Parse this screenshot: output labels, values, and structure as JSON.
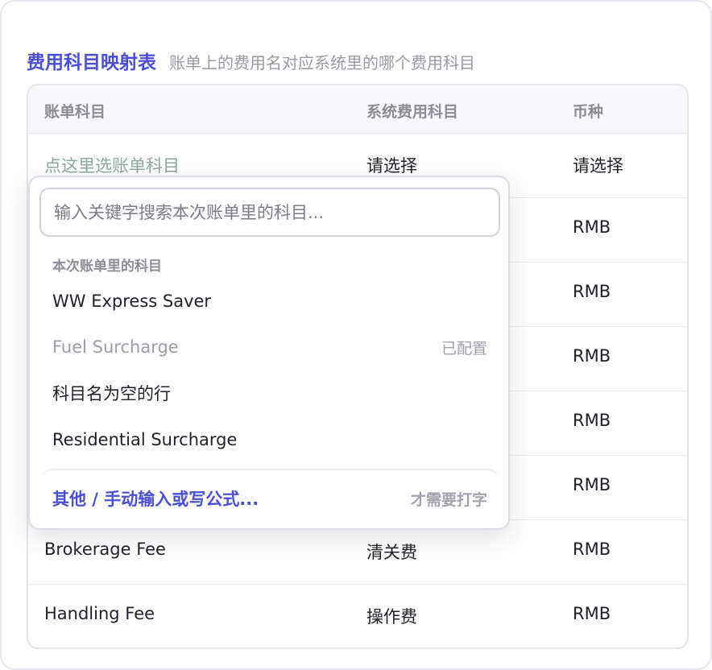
{
  "header": {
    "title": "费用科目映射表",
    "subtitle": "账单上的费用名对应系统里的哪个费用科目"
  },
  "table": {
    "columns": [
      "账单科目",
      "系统费用科目",
      "币种"
    ],
    "rows": [
      {
        "bill_item": "点这里选账单科目",
        "system_item": "请选择",
        "currency": "请选择"
      },
      {
        "bill_item": "",
        "system_item": "",
        "currency": "RMB"
      },
      {
        "bill_item": "",
        "system_item": "",
        "currency": "RMB"
      },
      {
        "bill_item": "",
        "system_item": "",
        "currency": "RMB"
      },
      {
        "bill_item": "",
        "system_item": "",
        "currency": "RMB"
      },
      {
        "bill_item": "",
        "system_item": "",
        "currency": "RMB"
      },
      {
        "bill_item": "Brokerage Fee",
        "system_item": "清关费",
        "currency": "RMB"
      },
      {
        "bill_item": "Handling Fee",
        "system_item": "操作费",
        "currency": "RMB"
      }
    ]
  },
  "dropdown": {
    "search_placeholder": "输入关键字搜索本次账单里的科目...",
    "group_label": "本次账单里的科目",
    "options": [
      {
        "label": "WW Express Saver",
        "tag": "",
        "disabled": false
      },
      {
        "label": "Fuel Surcharge",
        "tag": "已配置",
        "disabled": true
      },
      {
        "label": "科目名为空的行",
        "tag": "",
        "disabled": false
      },
      {
        "label": "Residential Surcharge",
        "tag": "",
        "disabled": false
      }
    ],
    "footer_label": "其他 / 手动输入或写公式...",
    "footer_hint": "才需要打字"
  },
  "colors": {
    "accent": "#4a4ed8",
    "placeholder_green": "#8fa89d",
    "muted": "#9a9aa4"
  }
}
